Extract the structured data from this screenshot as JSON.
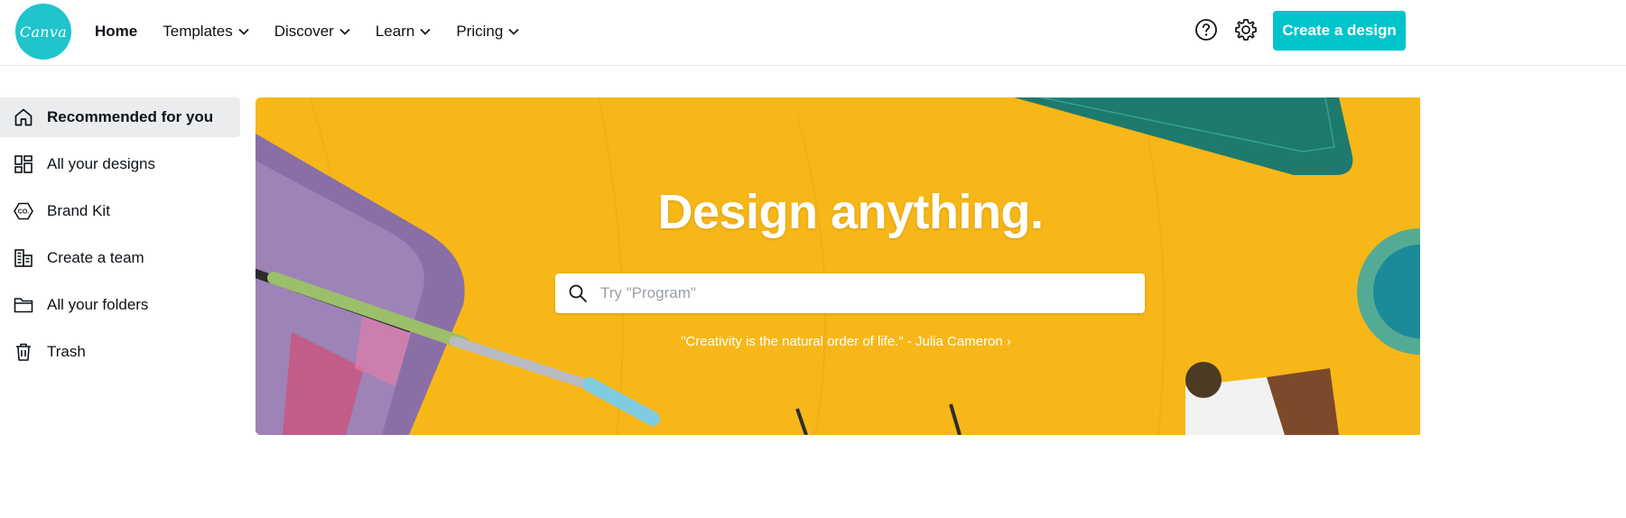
{
  "brand": {
    "logo_text": "Canva",
    "accent": "#00c4cc"
  },
  "nav": {
    "items": [
      {
        "label": "Home",
        "active": true,
        "dropdown": false
      },
      {
        "label": "Templates",
        "dropdown": true
      },
      {
        "label": "Discover",
        "dropdown": true
      },
      {
        "label": "Learn",
        "dropdown": true
      },
      {
        "label": "Pricing",
        "dropdown": true
      }
    ],
    "help_icon": "help-circle-icon",
    "settings_icon": "gear-icon",
    "create_button": "Create a design"
  },
  "sidebar": {
    "items": [
      {
        "label": "Recommended for you",
        "icon": "home-icon",
        "active": true
      },
      {
        "label": "All your designs",
        "icon": "grid-icon"
      },
      {
        "label": "Brand Kit",
        "icon": "brand-kit-icon"
      },
      {
        "label": "Create a team",
        "icon": "team-building-icon"
      },
      {
        "label": "All your folders",
        "icon": "folder-icon"
      },
      {
        "label": "Trash",
        "icon": "trash-icon"
      }
    ]
  },
  "hero": {
    "title": "Design anything.",
    "search_placeholder": "Try \"Program\"",
    "quote": "\"Creativity is the natural order of life.\" - Julia Cameron ›",
    "background_color": "#f7b718"
  }
}
